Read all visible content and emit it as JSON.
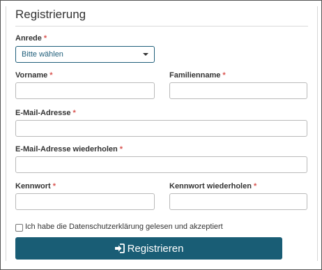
{
  "form": {
    "title": "Registrierung",
    "required_marker": "*",
    "salutation": {
      "label": "Anrede",
      "value": "Bitte wählen"
    },
    "first_name": {
      "label": "Vorname",
      "value": ""
    },
    "last_name": {
      "label": "Familienname",
      "value": ""
    },
    "email": {
      "label": "E-Mail-Adresse",
      "value": ""
    },
    "email_repeat": {
      "label": "E-Mail-Adresse wiederholen",
      "value": ""
    },
    "password": {
      "label": "Kennwort",
      "value": ""
    },
    "password_repeat": {
      "label": "Kennwort wiederholen",
      "value": ""
    },
    "privacy_checkbox": {
      "label": "Ich habe die Datenschutzerklärung gelesen und akzeptiert",
      "checked": false
    },
    "submit_label": "Registrieren",
    "submit_icon": "sign-in-icon"
  },
  "colors": {
    "accent": "#195d75",
    "required": "#d9534f"
  }
}
